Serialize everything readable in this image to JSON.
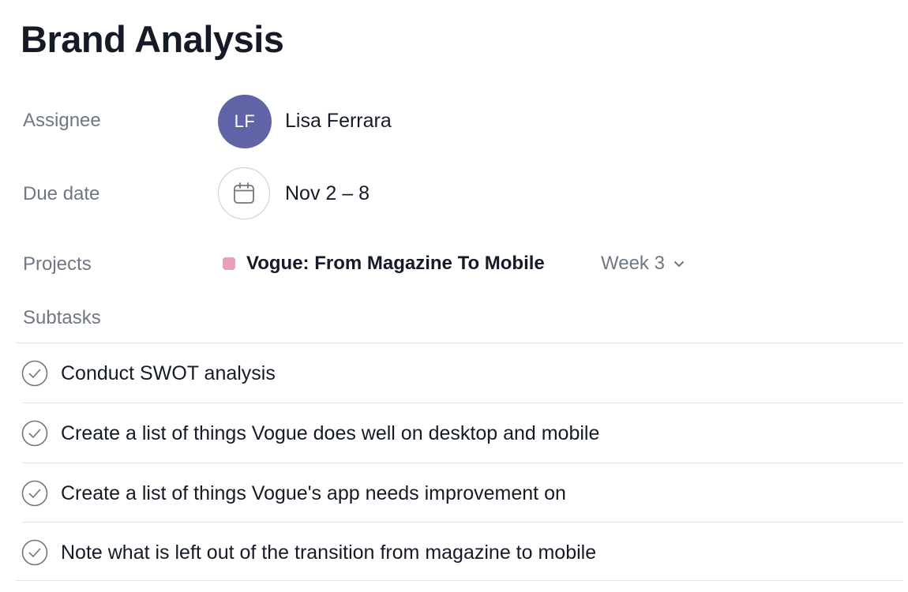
{
  "task": {
    "title": "Brand Analysis"
  },
  "fields": {
    "assignee": {
      "label": "Assignee",
      "initials": "LF",
      "name": "Lisa Ferrara",
      "avatar_color": "#6163a7"
    },
    "due_date": {
      "label": "Due date",
      "value": "Nov 2 – 8",
      "icon": "calendar-icon"
    },
    "projects": {
      "label": "Projects",
      "project_name": "Vogue: From Magazine To Mobile",
      "project_color": "#e8a0b4",
      "section": "Week 3",
      "section_icon": "chevron-down-icon"
    }
  },
  "subtasks": {
    "label": "Subtasks",
    "check_icon": "check-circle-icon",
    "items": [
      {
        "text": "Conduct SWOT analysis"
      },
      {
        "text": "Create a list of things Vogue does well on desktop and mobile"
      },
      {
        "text": "Create a list of things Vogue's app needs improvement on"
      },
      {
        "text": "Note what is left out of the transition from magazine to mobile"
      }
    ]
  }
}
